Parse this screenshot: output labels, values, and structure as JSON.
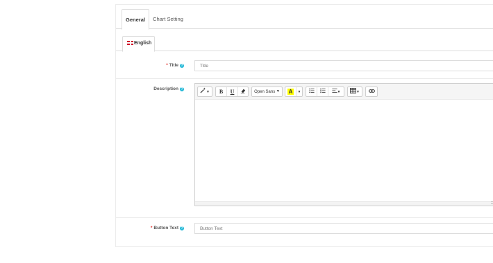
{
  "tabs": [
    {
      "label": "General",
      "active": true
    },
    {
      "label": "Chart Setting",
      "active": false
    }
  ],
  "language_tab": {
    "label": "English",
    "flag_icon": "uk-flag-icon"
  },
  "fields": {
    "title": {
      "label": "Title",
      "required": true,
      "placeholder": "Title"
    },
    "description": {
      "label": "Description",
      "required": false
    },
    "button_text": {
      "label": "Button Text",
      "required": true,
      "placeholder": "Button Text"
    }
  },
  "toolbar": {
    "magic_icon": "magic-wand-icon",
    "bold_label": "B",
    "underline_label": "U",
    "eraser_icon": "eraser-icon",
    "font_family": "Open Sans",
    "text_color_label": "A",
    "bullet_list_icon": "bullet-list-icon",
    "numbered_list_icon": "numbered-list-icon",
    "align_icon": "align-left-icon",
    "table_icon": "table-icon",
    "link_icon": "link-icon"
  },
  "colors": {
    "required": "#e2302a",
    "help": "#25b9d7",
    "highlight": "#ffff00"
  }
}
